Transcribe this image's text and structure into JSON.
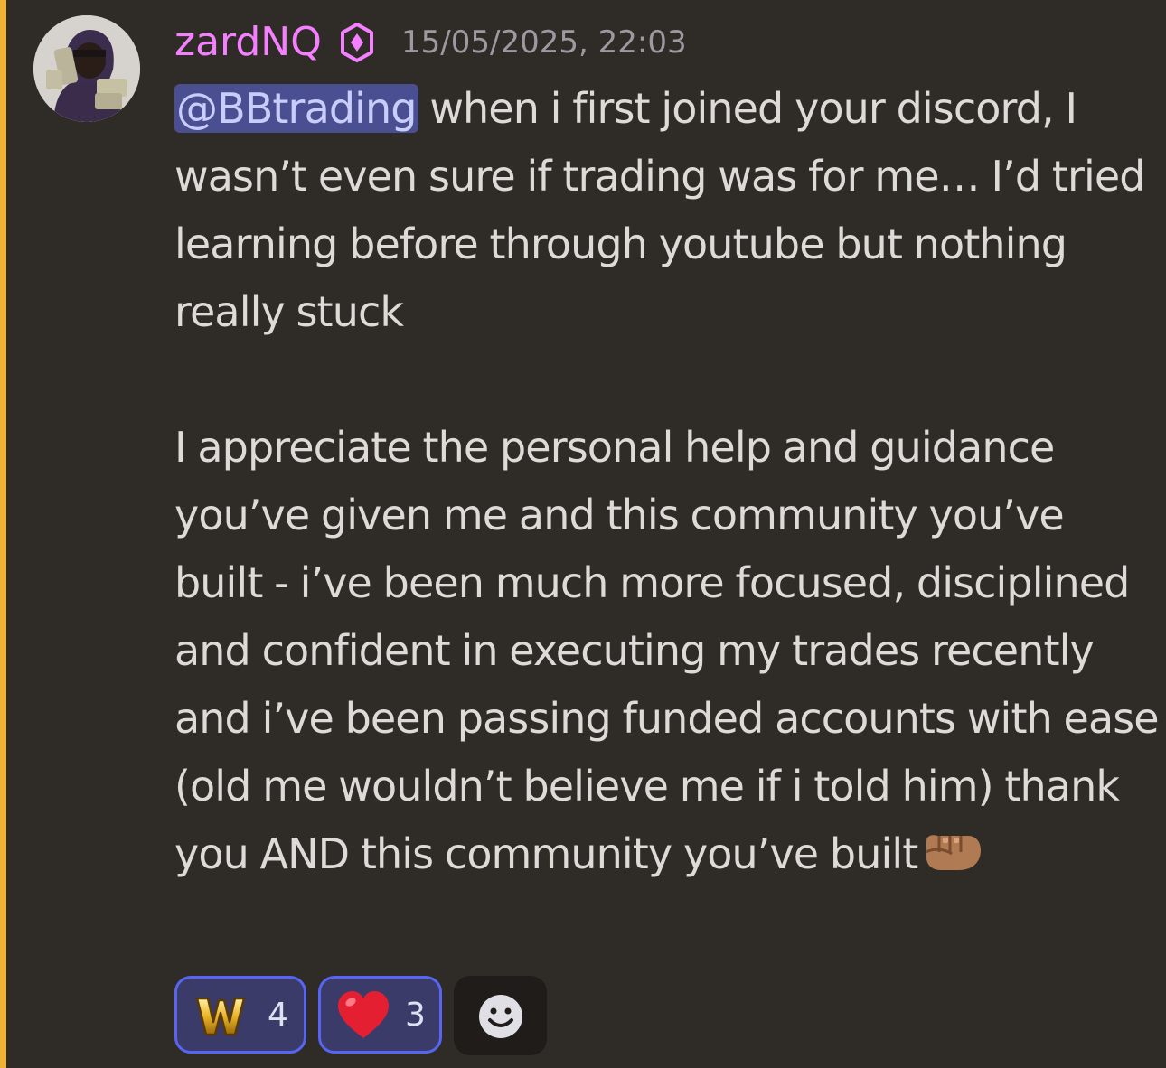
{
  "message": {
    "author": {
      "username": "zardNQ",
      "username_color": "#f47fff",
      "avatar_icon": "user-avatar",
      "role_icon": "hexagon-role-icon"
    },
    "timestamp": "15/05/2025, 22:03",
    "mention": "@BBtrading",
    "paragraph_1_text": " when i first joined your discord, I wasn’t even sure if trading was for me… I’d tried learning before through youtube but nothing really stuck",
    "paragraph_2_text": "I appreciate the personal help and guidance you’ve given me and this community you’ve built - i’ve been much more focused, disciplined and confident in executing my trades recently and i’ve been passing funded accounts with ease (old me wouldn’t believe me if i told him) thank you AND this community you’ve built",
    "trailing_emoji": "fist-emoji",
    "mention_highlight_color": "#f0b232"
  },
  "reactions": [
    {
      "emoji": "W",
      "emoji_icon": "gold-w-emoji",
      "count": "4",
      "reacted": true
    },
    {
      "emoji": "❤️",
      "emoji_icon": "heart-emoji",
      "count": "3",
      "reacted": true
    }
  ],
  "add_reaction": {
    "icon": "smiley-icon"
  }
}
